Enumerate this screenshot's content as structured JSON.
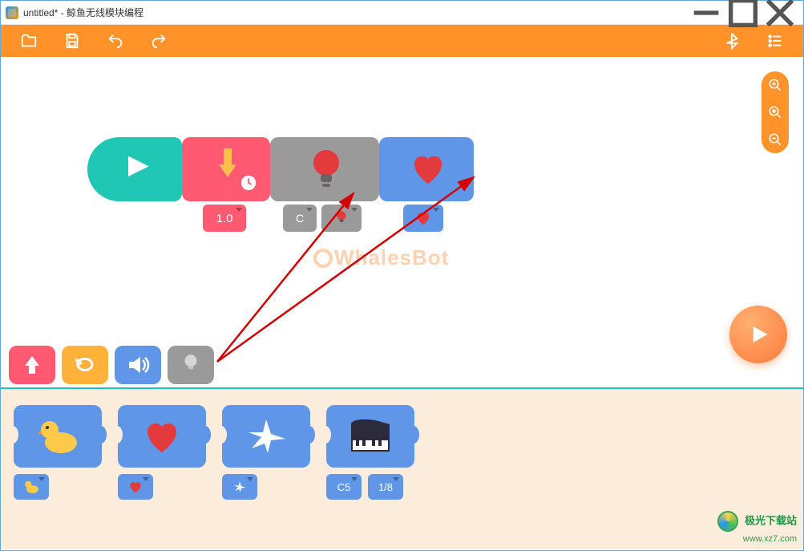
{
  "window": {
    "title": "untitled*  - 鲸鱼无线模块编程"
  },
  "toolbar": {
    "open": "open",
    "save": "save",
    "undo": "undo",
    "redo": "redo",
    "bluetooth": "bluetooth",
    "menu": "menu"
  },
  "zoom": {
    "in": "zoom-in",
    "reset": "zoom-reset",
    "out": "zoom-out"
  },
  "watermark": "WhalesBot",
  "program": {
    "start": "start",
    "timer": {
      "value": "1.0"
    },
    "light": {
      "port": "C",
      "color": "bulb"
    },
    "display": {
      "pattern": "heart"
    }
  },
  "categories": [
    "upload",
    "loop",
    "sound",
    "light"
  ],
  "palette": {
    "items": [
      {
        "name": "duck",
        "params": [
          "duck"
        ]
      },
      {
        "name": "heart",
        "params": [
          "heart"
        ]
      },
      {
        "name": "plane",
        "params": [
          "plane"
        ]
      },
      {
        "name": "piano",
        "params": [
          "C5",
          "1/8"
        ]
      }
    ]
  },
  "run": "run",
  "badge": {
    "line1": "极光下载站",
    "line2": "www.xz7.com"
  }
}
